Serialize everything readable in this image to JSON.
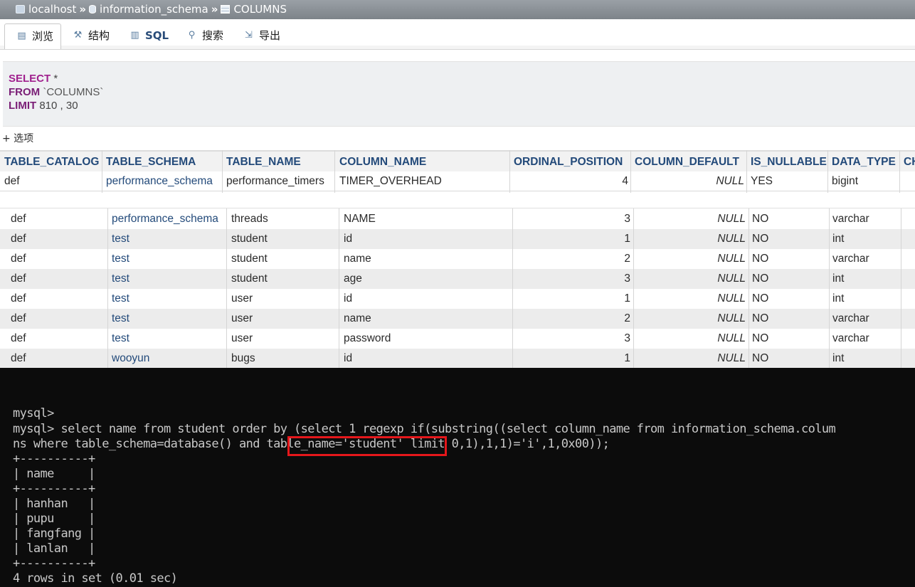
{
  "breadcrumb": {
    "server": "localhost",
    "database": "information_schema",
    "table": "COLUMNS",
    "separator": "»"
  },
  "tabs": [
    {
      "label": "浏览",
      "icon": "browse-icon",
      "active": true
    },
    {
      "label": "结构",
      "icon": "structure-icon"
    },
    {
      "label": "SQL",
      "icon": "sql-icon"
    },
    {
      "label": "搜索",
      "icon": "search-icon"
    },
    {
      "label": "导出",
      "icon": "export-icon"
    }
  ],
  "sql": {
    "select_kw": "SELECT",
    "star": "*",
    "from_kw": "FROM",
    "table": "`COLUMNS`",
    "limit_kw": "LIMIT",
    "limit_values": "810 , 30"
  },
  "options_label": "+ 选项",
  "table": {
    "headers": [
      "TABLE_CATALOG",
      "TABLE_SCHEMA",
      "TABLE_NAME",
      "COLUMN_NAME",
      "ORDINAL_POSITION",
      "COLUMN_DEFAULT",
      "IS_NULLABLE",
      "DATA_TYPE",
      "CH"
    ],
    "first_row": [
      "def",
      "performance_schema",
      "performance_timers",
      "TIMER_OVERHEAD",
      "4",
      "NULL",
      "YES",
      "bigint"
    ],
    "rows": [
      [
        "def",
        "performance_schema",
        "threads",
        "NAME",
        "3",
        "NULL",
        "NO",
        "varchar"
      ],
      [
        "def",
        "test",
        "student",
        "id",
        "1",
        "NULL",
        "NO",
        "int"
      ],
      [
        "def",
        "test",
        "student",
        "name",
        "2",
        "NULL",
        "NO",
        "varchar"
      ],
      [
        "def",
        "test",
        "student",
        "age",
        "3",
        "NULL",
        "NO",
        "int"
      ],
      [
        "def",
        "test",
        "user",
        "id",
        "1",
        "NULL",
        "NO",
        "int"
      ],
      [
        "def",
        "test",
        "user",
        "name",
        "2",
        "NULL",
        "NO",
        "varchar"
      ],
      [
        "def",
        "test",
        "user",
        "password",
        "3",
        "NULL",
        "NO",
        "varchar"
      ],
      [
        "def",
        "wooyun",
        "bugs",
        "id",
        "1",
        "NULL",
        "NO",
        "int"
      ]
    ]
  },
  "terminal": {
    "lines": [
      "mysql>",
      "mysql> select name from student order by (select 1 regexp if(substring((select column_name from information_schema.colum",
      "ns where table_schema=database() and table_name='student' limit 0,1),1,1)='i',1,0x00));",
      "+----------+",
      "| name     |",
      "+----------+",
      "| hanhan   |",
      "| pupu     |",
      "| fangfang |",
      "| lanlan   |",
      "+----------+",
      "4 rows in set (0.01 sec)"
    ],
    "highlight_color": "#e5171b"
  }
}
